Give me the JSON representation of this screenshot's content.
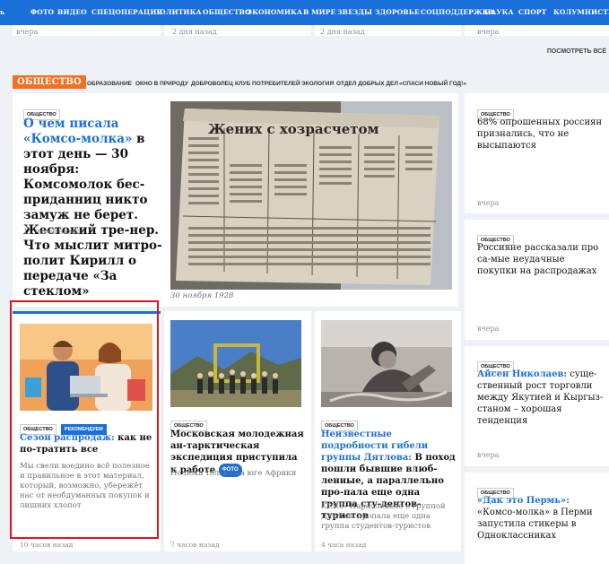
{
  "nav": [
    "ь",
    "ФОТО",
    "ВИДЕО",
    "СПЕЦОПЕРАЦИЯ",
    "ПОЛИТИКА",
    "ОБЩЕСТВО",
    "ЭКОНОМИКА",
    "В МИРЕ",
    "ЗВЕЗДЫ",
    "ЗДОРОВЬЕ",
    "СОЦПОДДЕРЖКА",
    "НАУКА",
    "СПОРТ",
    "КОЛУМНИСТЫ"
  ],
  "strip": {
    "t1": "вчера",
    "t2": "2 дня назад",
    "t3": "2 дня назад",
    "t4": "вчера",
    "more": "ПОСМОТРЕТЬ ВСЁ"
  },
  "section": {
    "badge": "ОБЩЕСТВО",
    "subtabs": [
      "ОБРАЗОВАНИЕ",
      "ОКНО В ПРИРОДУ",
      "ДОБРОВОЛЕЦ",
      "КЛУБ ПОТРЕБИТЕЛЕЙ",
      "ЭКОЛОГИЯ",
      "ОТДЕЛ ДОБРЫХ ДЕЛ",
      "«СПАСИ НОВЫЙ ГОД!»"
    ]
  },
  "main": {
    "tag": "ОБЩЕСТВО",
    "title_blue": "О чем писала «Комсо-молка»",
    "title_rest": "в этот день — 30 ноября: Комсомолок бес-приданниц никто замуж не берет. Жестокий тре-нер. Что мыслит митро-полит Кирилл о передаче «За стеклом»",
    "time": "11 часов назад",
    "caption": "30 ноября 1928",
    "photo_header": "Жених с хозрасчетом"
  },
  "right": [
    {
      "tag": "ОБЩЕСТВО",
      "title": "68% опрошенных россиян признались, что не высыпаются",
      "time": "вчера"
    },
    {
      "tag": "ОБЩЕСТВО",
      "title": "Россияне рассказали про са-мые неудачные покупки на распродажах",
      "time": "вчера"
    },
    {
      "tag": "ОБЩЕСТВО",
      "title_blue": "Айсен Николаев:",
      "title_rest": "суще-ственный рост торговли между Якутией и Кыргыз-станом – хорошая тенденция",
      "time": "вчера"
    },
    {
      "tag": "ОБЩЕСТВО",
      "title_blue": "«Дак это Пермь»:",
      "title_rest": "«Комсо-молка» в Перми запустила стикеры в Одноклассниках"
    }
  ],
  "bottom": [
    {
      "tags": [
        "ОБЩЕСТВО",
        "РЕКОМЕНДУЕМ"
      ],
      "title_blue": "Сезон распродаж:",
      "title_rest": "как не по-тратить все",
      "lead": "Мы свели воедино всё полезное и правильное в этот материал, который, возможно, убережёт нас от необдуманных покупок и лишних хлопот",
      "time": "10 часов назад"
    },
    {
      "tags": [
        "ОБЩЕСТВО"
      ],
      "title": "Московская молодежная ан-тарктическая экспедиция приступила к работе",
      "badge": "ФОТО",
      "lead": "Но пока только на юге Африки",
      "time": "7 часов назад"
    },
    {
      "tags": [
        "ОБЩЕСТВО"
      ],
      "title_blue": "Неизвестные подробности гибели группы Дятлова:",
      "title_rest": "В поход пошли бывшие влюб-ленные, а параллельно про-пала еще одна группа сту-дентов-туристов",
      "lead": "KP.RU: Параллельно с группой Дятлова пропала еще одна группа студентов-туристов",
      "time": "4 часа назад"
    }
  ]
}
